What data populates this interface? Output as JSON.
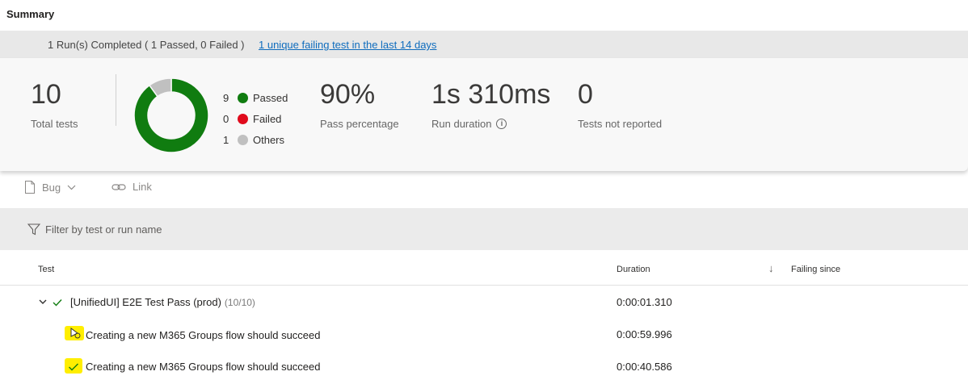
{
  "header": {
    "title": "Summary"
  },
  "run_banner": {
    "summary": "1 Run(s) Completed ( 1 Passed, 0 Failed )",
    "failing_link": "1 unique failing test in the last 14 days"
  },
  "metrics": {
    "total_tests": {
      "value": "10",
      "label": "Total tests"
    },
    "pass_percentage": {
      "value": "90%",
      "label": "Pass percentage"
    },
    "run_duration": {
      "value": "1s 310ms",
      "label": "Run duration"
    },
    "not_reported": {
      "value": "0",
      "label": "Tests not reported"
    }
  },
  "outcome_chart": {
    "type": "pie",
    "slices": [
      {
        "label": "Passed",
        "count": 9,
        "color": "#107c10"
      },
      {
        "label": "Failed",
        "count": 0,
        "color": "#e00b1c"
      },
      {
        "label": "Others",
        "count": 1,
        "color": "#c0c0c0"
      }
    ]
  },
  "toolbar": {
    "bug_label": "Bug",
    "link_label": "Link"
  },
  "filter": {
    "placeholder": "Filter by test or run name"
  },
  "table": {
    "columns": {
      "test": "Test",
      "duration": "Duration",
      "failing_since": "Failing since"
    },
    "group": {
      "name": "[UnifiedUI] E2E Test Pass (prod)",
      "count": "(10/10)",
      "duration": "0:00:01.310"
    },
    "rows": [
      {
        "name": "Creating a new M365 Groups flow should succeed",
        "duration": "0:00:59.996",
        "status_icon": "other-status-icon"
      },
      {
        "name": "Creating a new M365 Groups flow should succeed",
        "duration": "0:00:40.586",
        "status_icon": "passed-check-icon"
      }
    ]
  },
  "colors": {
    "passed": "#107c10",
    "failed": "#e00b1c",
    "others": "#c0c0c0",
    "link": "#0f6cbd",
    "highlight": "#ffee00"
  }
}
